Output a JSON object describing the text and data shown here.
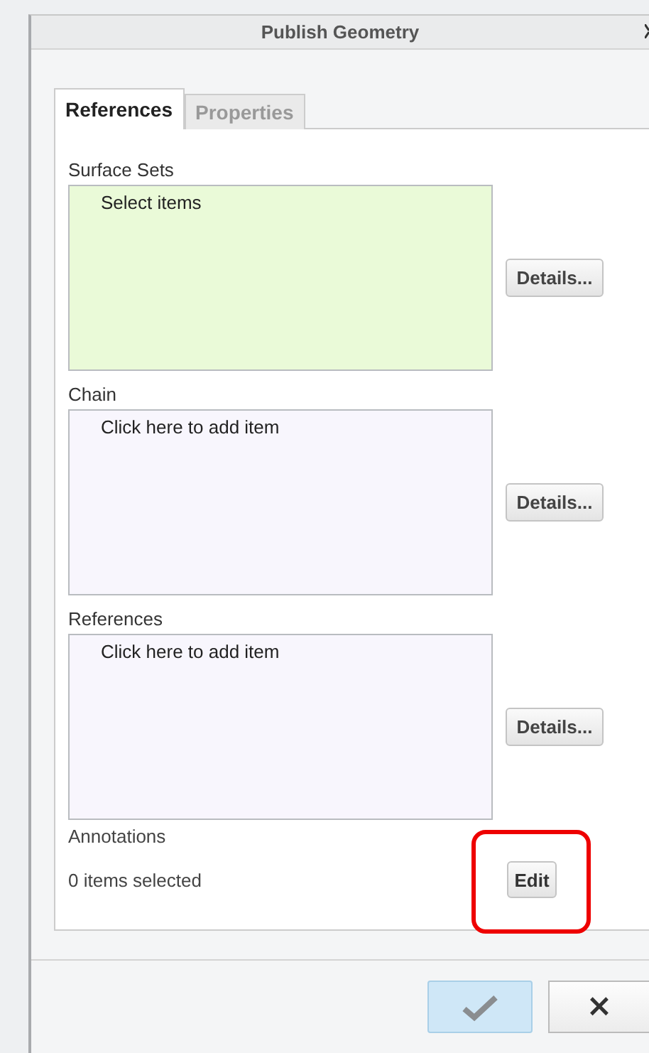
{
  "window": {
    "title": "Publish Geometry"
  },
  "tabs": [
    {
      "label": "References",
      "selected": true
    },
    {
      "label": "Properties",
      "selected": false
    }
  ],
  "collectors": [
    {
      "label": "Surface Sets",
      "placeholder": "Select items",
      "active": true,
      "button": "Details..."
    },
    {
      "label": "Chain",
      "placeholder": "Click here to add item",
      "active": false,
      "button": "Details..."
    },
    {
      "label": "References",
      "placeholder": "Click here to add item",
      "active": false,
      "button": "Details..."
    }
  ],
  "annotations": {
    "label": "Annotations",
    "status": "0 items selected",
    "button": "Edit",
    "highlighted": true
  },
  "footer": {
    "ok_enabled": true,
    "cancel": "×"
  }
}
